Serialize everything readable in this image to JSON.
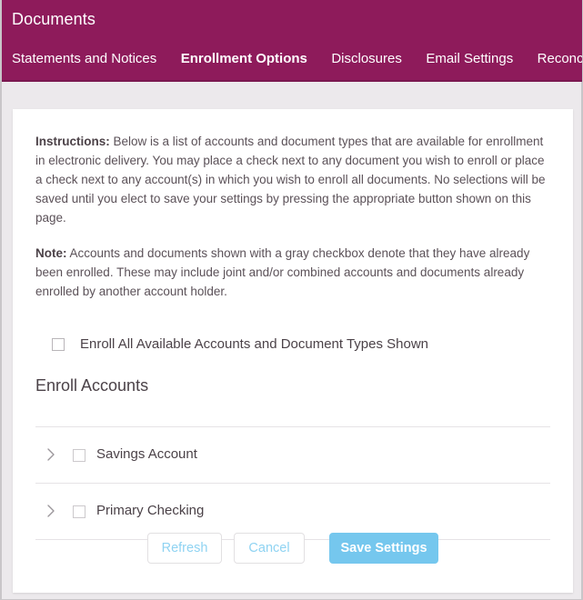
{
  "header": {
    "title": "Documents",
    "background_color": "#8e1b5b",
    "nav": [
      {
        "label": "Statements and Notices",
        "active": false
      },
      {
        "label": "Enrollment Options",
        "active": true
      },
      {
        "label": "Disclosures",
        "active": false
      },
      {
        "label": "Email Settings",
        "active": false
      },
      {
        "label": "Reconciliation W",
        "active": false
      }
    ]
  },
  "main": {
    "instructions": {
      "lead": "Instructions:",
      "text": " Below is a list of accounts and document types that are available for enrollment in electronic delivery. You may place a check next to any document you wish to enroll or place a check next to any account(s) in which you wish to enroll all documents. No selections will be saved until you elect to save your settings by pressing the appropriate button shown on this page."
    },
    "note": {
      "lead": "Note:",
      "text": " Accounts and documents shown with a gray checkbox denote that they have already been enrolled. These may include joint and/or combined accounts and documents already enrolled by another account holder."
    },
    "enroll_all": {
      "label": "Enroll All Available Accounts and Document Types Shown",
      "checked": false
    },
    "section_heading": "Enroll Accounts",
    "accounts": [
      {
        "label": "Savings Account",
        "checked": false,
        "expanded": false,
        "expand_icon": "chevron-right-icon"
      },
      {
        "label": "Primary Checking",
        "checked": false,
        "expanded": false,
        "expand_icon": "chevron-right-icon"
      }
    ],
    "buttons": {
      "refresh": "Refresh",
      "cancel": "Cancel",
      "save": "Save Settings",
      "primary_color": "#75c7ee",
      "outline_text_color": "#8fd3f2"
    }
  }
}
